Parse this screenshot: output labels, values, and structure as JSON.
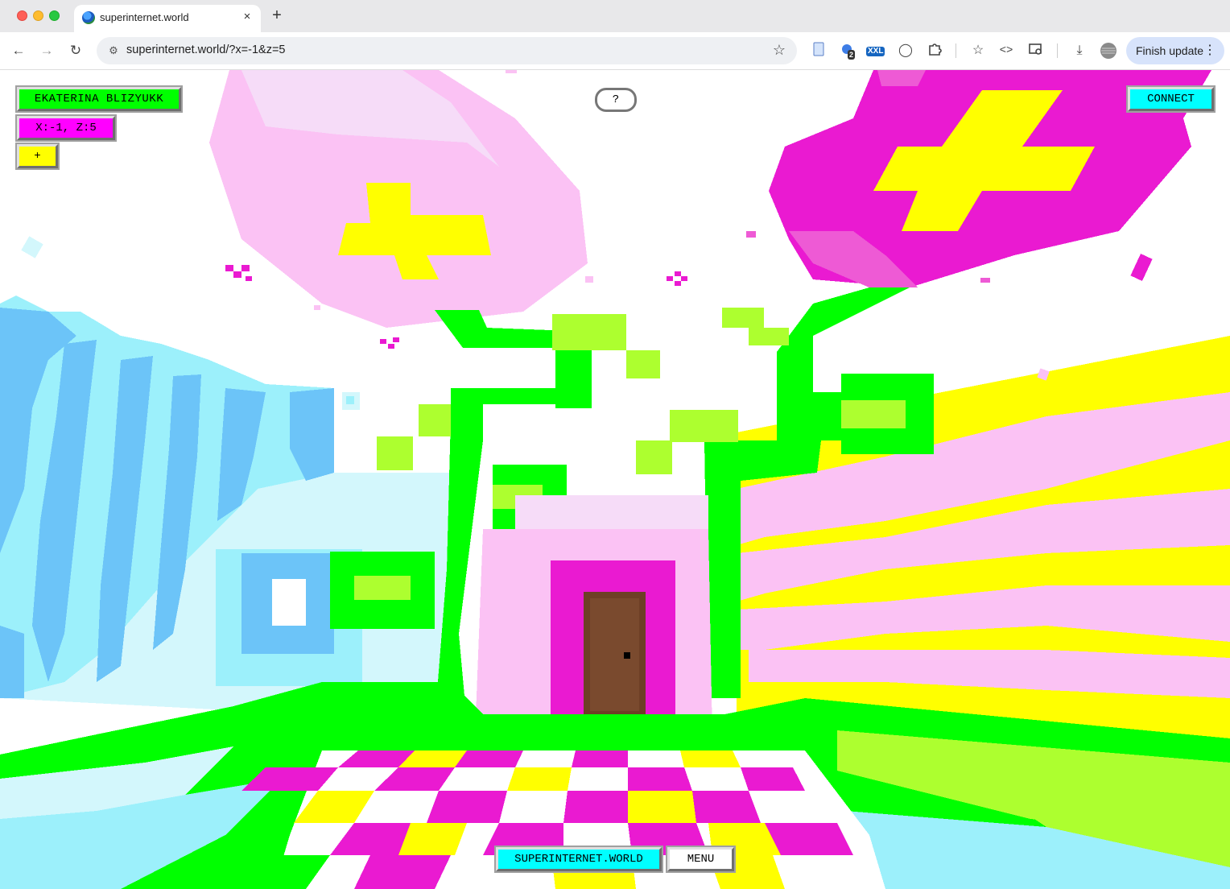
{
  "browser": {
    "tab_title": "superinternet.world",
    "tab_close": "×",
    "new_tab": "+",
    "url": "superinternet.world/?x=-1&z=5",
    "extension_badge_count": "2",
    "extension_badge_label": "XXL",
    "finish_update_label": "Finish update",
    "icons": [
      "back-icon",
      "forward-icon",
      "reload-icon",
      "site-info-icon",
      "bookmark-star-icon",
      "document-icon",
      "extension-icon",
      "xxl-extension-icon",
      "circle-extension-icon",
      "puzzle-icon",
      "bookmarks-icon",
      "code-icon",
      "screen-search-icon",
      "download-icon",
      "profile-avatar-icon",
      "more-menu-icon"
    ]
  },
  "hud": {
    "player_name": "EKATERINA BLIZYUKK",
    "coords": "X:-1, Z:5",
    "add_button": "+",
    "help_button": "?",
    "connect_button": "CONNECT",
    "world_button": "SUPERINTERNET.WORLD",
    "menu_button": "MENU"
  },
  "colors": {
    "hud_green": "#00ff00",
    "hud_magenta": "#ff00ff",
    "hud_yellow": "#ffff00",
    "hud_cyan": "#00ffff",
    "scene_pink": "#fbc2f4",
    "scene_magenta": "#ea1ad1",
    "scene_lime": "#adff2f",
    "scene_blue": "#6cc4f8",
    "scene_lightblue": "#9cf0fb",
    "door_brown": "#6e3f26"
  }
}
